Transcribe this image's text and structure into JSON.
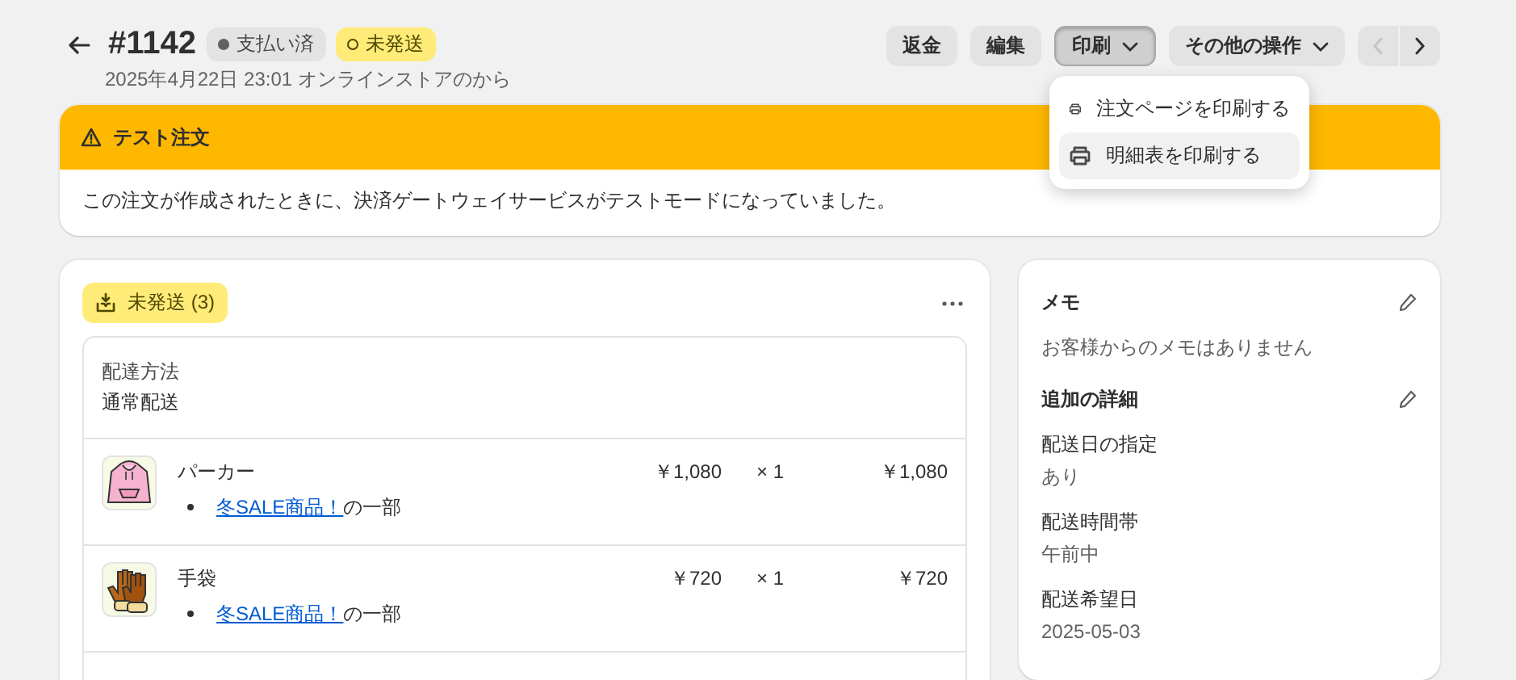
{
  "header": {
    "title": "#1142",
    "subtitle": "2025年4月22日 23:01 オンラインストアのから",
    "badges": [
      {
        "label": "支払い済",
        "kind": "paid"
      },
      {
        "label": "未発送",
        "kind": "unfulfilled"
      }
    ]
  },
  "actions": [
    {
      "label": "返金",
      "kind": "plain",
      "pressed": false
    },
    {
      "label": "編集",
      "kind": "plain",
      "pressed": false
    },
    {
      "label": "印刷",
      "kind": "menu",
      "pressed": true
    },
    {
      "label": "その他の操作",
      "kind": "menu",
      "pressed": false
    }
  ],
  "pager": [
    {
      "kind": "previous",
      "disabled": true
    },
    {
      "kind": "next",
      "disabled": false
    }
  ],
  "print_menu": {
    "items": [
      {
        "label": "注文ページを印刷する",
        "selected": false
      },
      {
        "label": "明細表を印刷する",
        "selected": true
      }
    ]
  },
  "banner": {
    "title": "テスト注文",
    "message": "この注文が作成されたときに、決済ゲートウェイサービスがテストモードになっていました。"
  },
  "fulfillment": {
    "status": "未発送 (3)",
    "delivery_label": "配達方法",
    "delivery_method": "通常配送",
    "items": [
      {
        "kind": "hoodie",
        "name": "パーカー",
        "link": "冬SALE商品！",
        "note": "の一部",
        "price": "￥1,080",
        "quantity": "× 1",
        "total": "￥1,080"
      },
      {
        "kind": "gloves",
        "name": "手袋",
        "link": "冬SALE商品！",
        "note": "の一部",
        "price": "￥720",
        "quantity": "× 1",
        "total": "￥720"
      }
    ]
  },
  "notes": {
    "title": "メモ",
    "empty": "お客様からのメモはありません"
  },
  "details": {
    "title": "追加の詳細",
    "fields": [
      {
        "label": "配送日の指定",
        "value": "あり"
      },
      {
        "label": "配送時間帯",
        "value": "午前中"
      },
      {
        "label": "配送希望日",
        "value": "2025-05-03"
      }
    ]
  }
}
